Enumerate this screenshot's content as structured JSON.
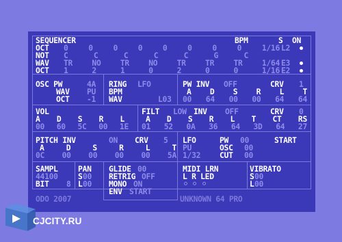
{
  "sequencer": {
    "title": "SEQUENCER",
    "bpm_label": "BPM",
    "s_label": "S",
    "on_label": "ON",
    "rows": [
      {
        "label": "OCT",
        "values": "0 0 0 0 0 0 0 0 1/16",
        "tail": "L2"
      },
      {
        "label": "NOT",
        "values": "C C C C C G C",
        "tail": ""
      },
      {
        "label": "WAV",
        "values": "TR NO TR NO TR TR TR 1/64",
        "tail": "E3"
      },
      {
        "label": "OCT",
        "values": "1 2 1 0 2 0 0 1/16",
        "tail": "E2"
      }
    ]
  },
  "osc": {
    "pw_label": "OSC PW",
    "pw_value": "4A",
    "wav_label": "WAV",
    "wav_value": "PU",
    "oct_label": "OCT",
    "oct_value": "-1"
  },
  "ring": {
    "ring_label": "RING",
    "ring_value": "LFO",
    "bpm_label": "BPM",
    "wav_label": "WAV",
    "tail": "L03"
  },
  "pwinv": {
    "title": "PW INV",
    "inv_value": "OFF",
    "crv_label": "CRV",
    "crv_value": "1",
    "adsr": "A D S R L T",
    "values": "00 64 00 00 64 64"
  },
  "vol": {
    "title": "VOL",
    "adsr": "A D S R L",
    "values": "00 60 5C 00 1E"
  },
  "filt": {
    "title": "FILT",
    "mode": "LOW",
    "inv_label": "INV",
    "inv_value": "OFF",
    "crv_label": "CRV",
    "crv_value": "0",
    "adsr": "A D S R L T CT RS",
    "values": "01 52 0A 36 64 3D 64 27"
  },
  "pitch": {
    "title": "PITCH INV",
    "inv_value": "ON",
    "crv_label": "CRV",
    "crv_value": "5",
    "adsr": "A D S R L T",
    "values": "0C 00 00 00 00 5A"
  },
  "lfo": {
    "title": "LFO",
    "pw_label": "PW",
    "pw_value": "00",
    "start_label": "START",
    "wave": "PU",
    "osc_label": "OSC",
    "osc_value": "00",
    "rate": "1/32",
    "cut_label": "CUT",
    "cut_value": "00"
  },
  "sampl": {
    "title": "SAMPL",
    "rate": "44100",
    "bit_label": "BIT",
    "bit_value": "8"
  },
  "pan": {
    "title": "PAN",
    "s_label": "S",
    "s_value": "00",
    "l_label": "L",
    "l_value": "00"
  },
  "glide": {
    "glide_label": "GLIDE",
    "glide_value": "00",
    "retrig_label": "RETRIG",
    "retrig_value": "OFF",
    "mono_label": "MONO",
    "mono_value": "ON",
    "env_label": "ENV",
    "env_value": "START"
  },
  "midi": {
    "title": "MIDI LRN",
    "lr": "L R LED"
  },
  "vibrato": {
    "title": "VIBRATO",
    "s_label": "S",
    "s_value": "00",
    "l_label": "L",
    "l_value": "00"
  },
  "footer": {
    "left": "ODO 2007",
    "right": "UNKNOWN 64 PRO"
  },
  "watermark": {
    "text": "CJCITY.RU",
    "icon": "cjcity-logo-icon"
  },
  "colors": {
    "background": "#7d7be2",
    "screen": "#3c39b9",
    "bright": "#ffffff",
    "dim": "#8c8bea",
    "border": "#7b79da"
  }
}
